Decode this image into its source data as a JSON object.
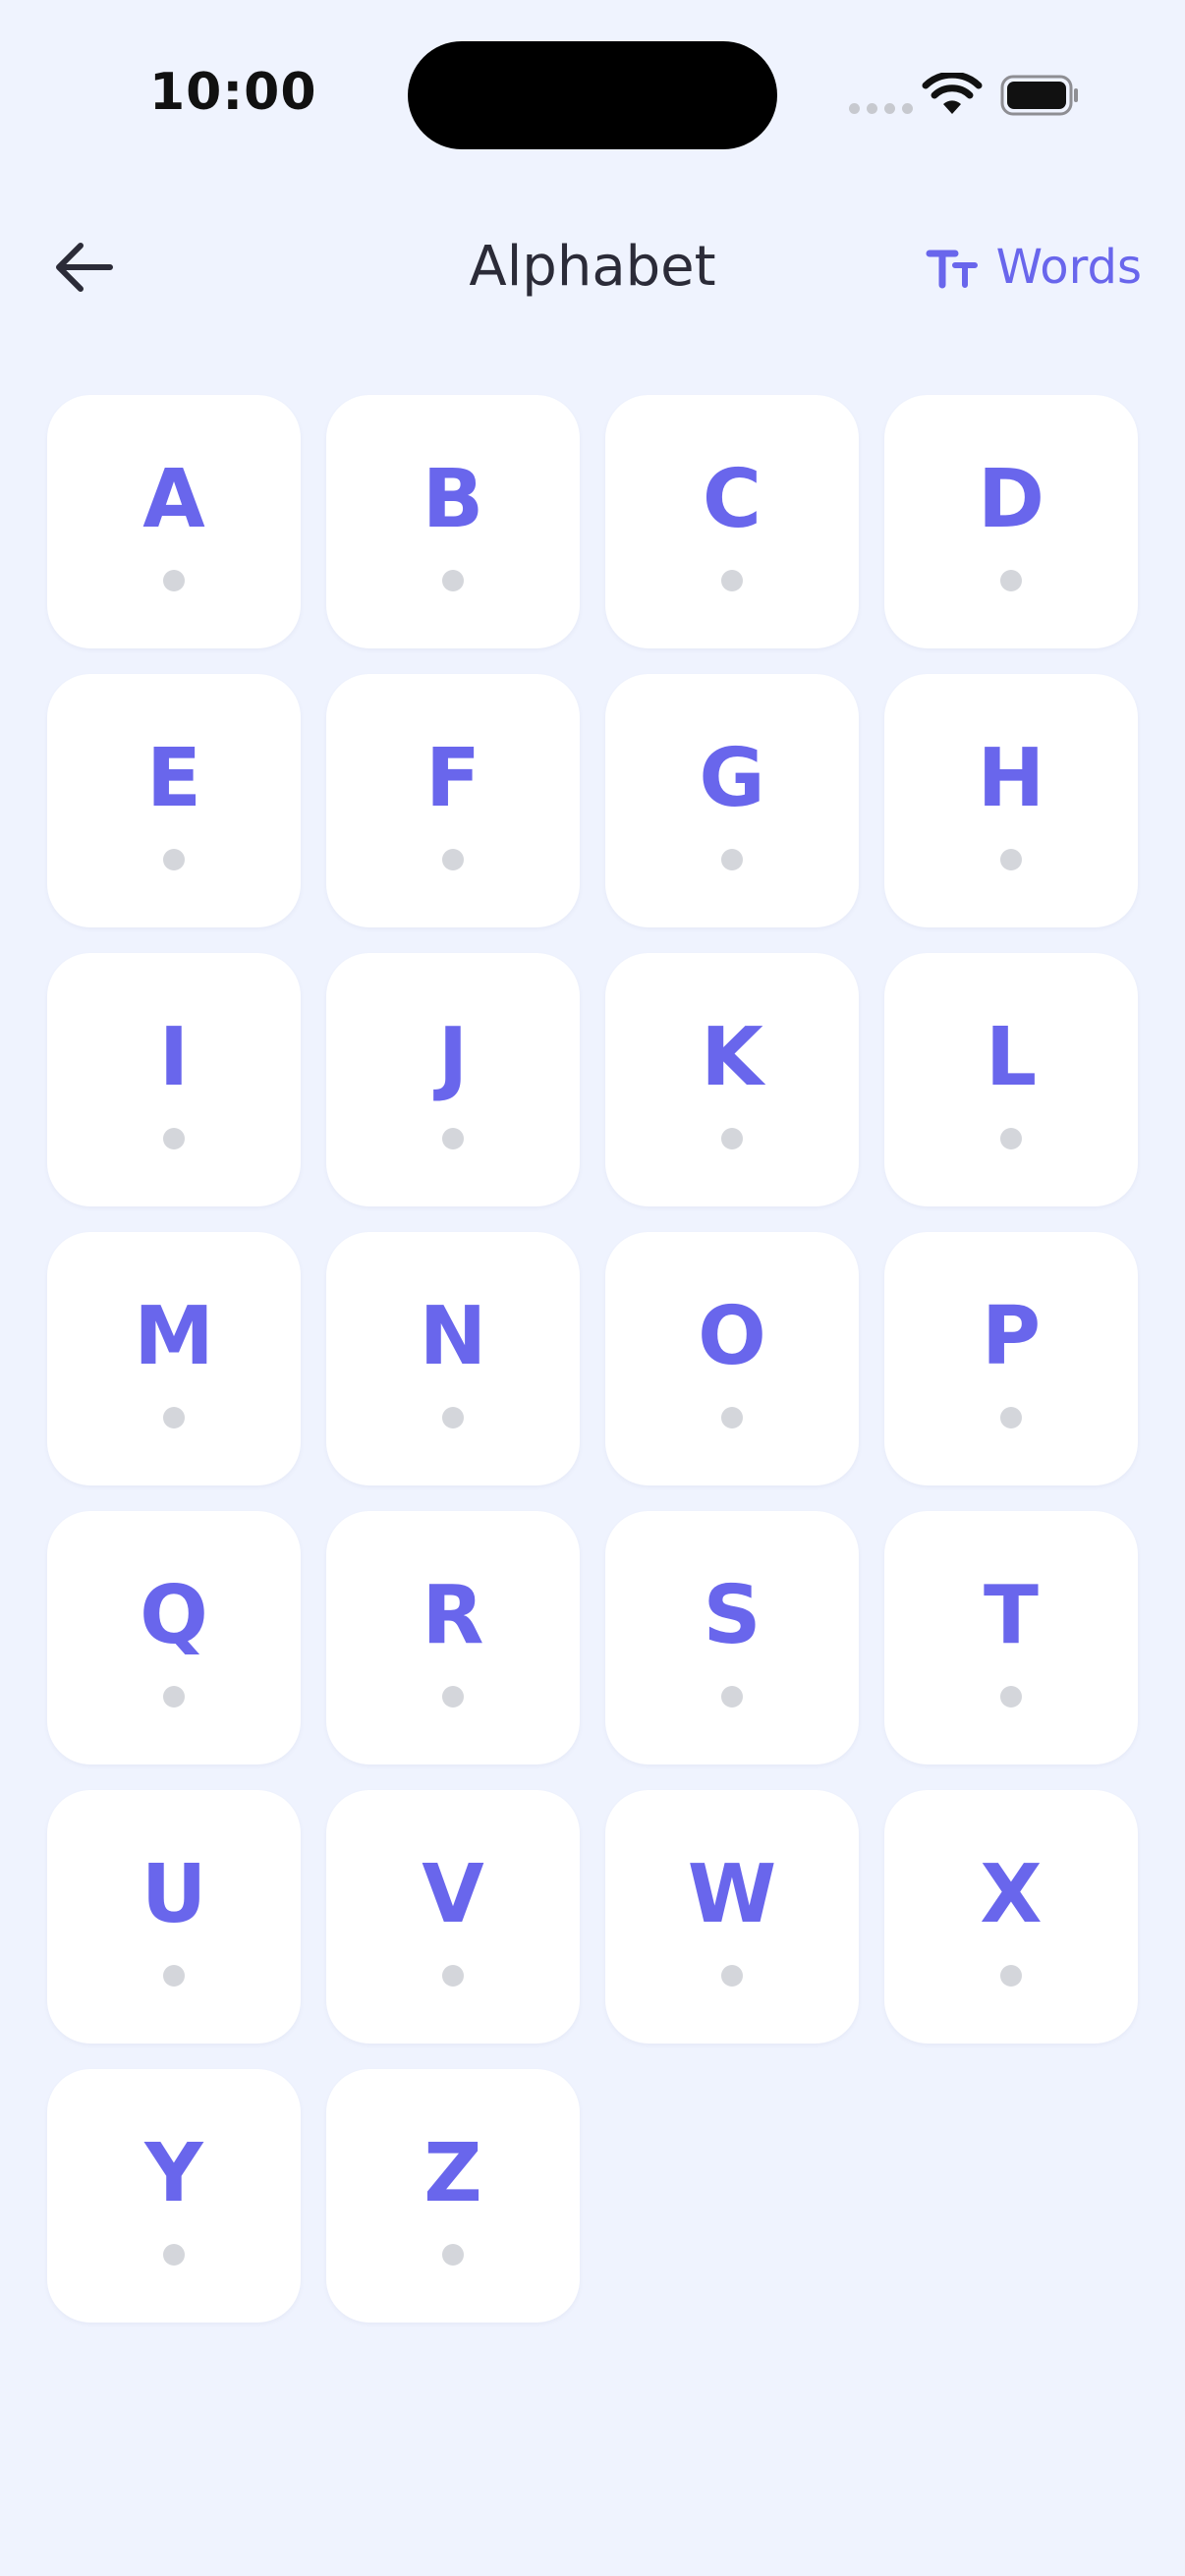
{
  "status_bar": {
    "time": "10:00"
  },
  "header": {
    "title": "Alphabet",
    "words_label": "Words",
    "back_icon": "arrow-left-icon",
    "words_icon": "text-size-icon"
  },
  "letters": [
    "A",
    "B",
    "C",
    "D",
    "E",
    "F",
    "G",
    "H",
    "I",
    "J",
    "K",
    "L",
    "M",
    "N",
    "O",
    "P",
    "Q",
    "R",
    "S",
    "T",
    "U",
    "V",
    "W",
    "X",
    "Y",
    "Z"
  ],
  "colors": {
    "background": "#EFF3FE",
    "accent": "#6966EC",
    "tile": "#FFFFFF",
    "dot": "#D4D6DB",
    "title": "#2B2B38"
  }
}
